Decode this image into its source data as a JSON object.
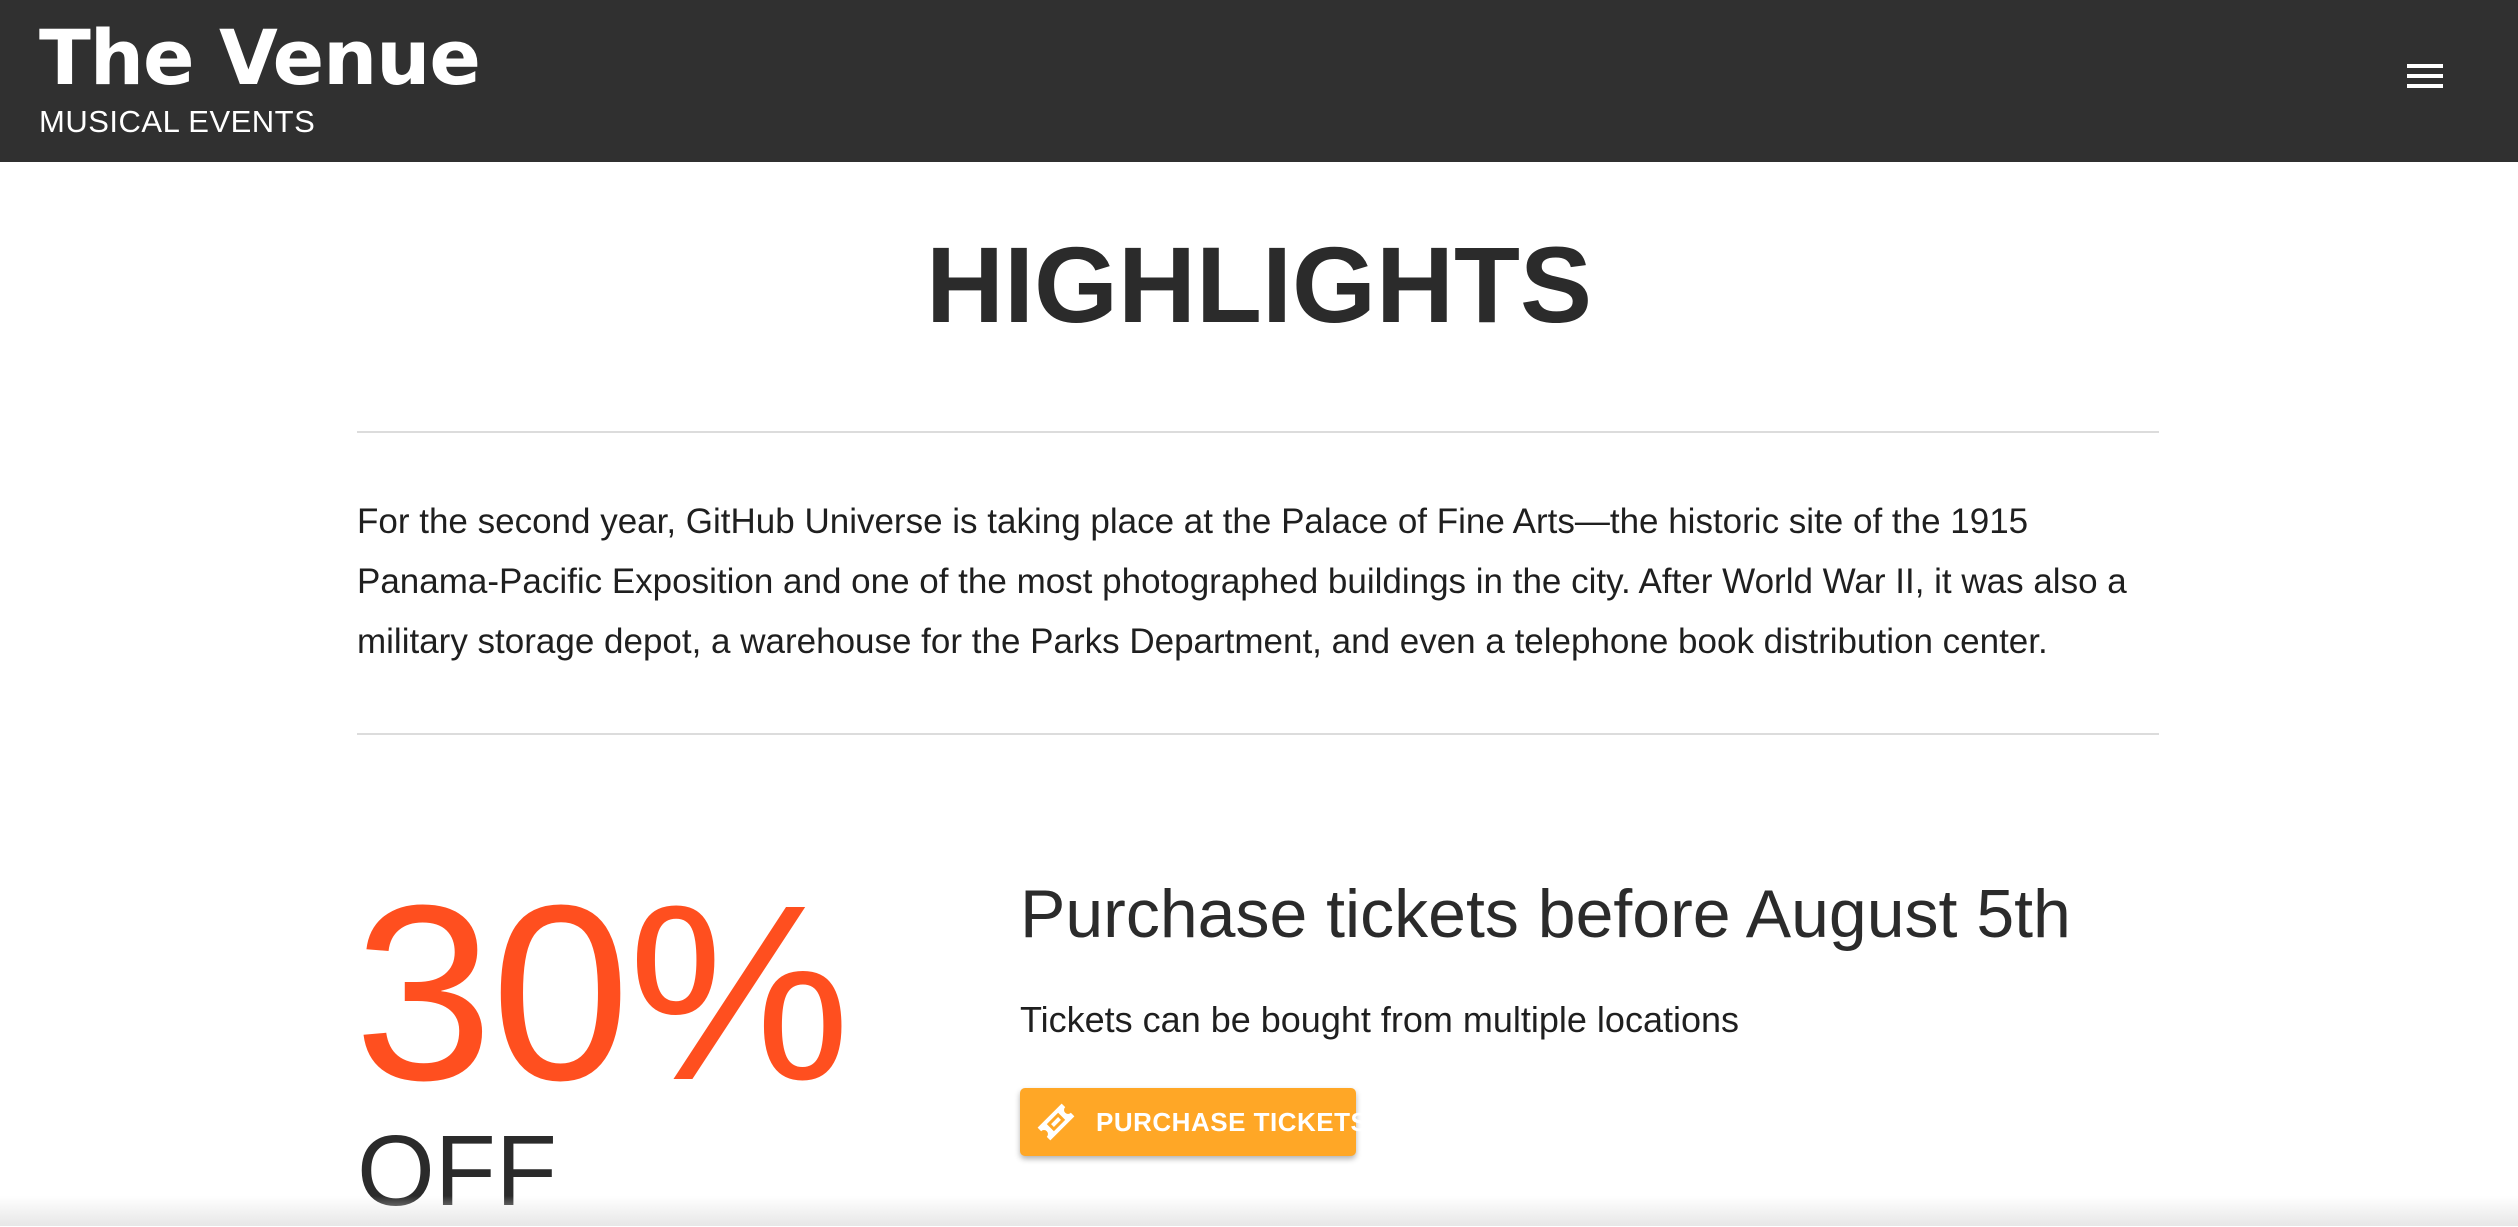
{
  "header": {
    "brand_title": "The Venue",
    "brand_subtitle": "MUSICAL EVENTS",
    "menu_icon": "hamburger-menu-icon",
    "background_color": "#303030"
  },
  "highlights": {
    "title": "HIGHLIGHTS",
    "intro": "For the second year, GitHub Universe is taking place at the Palace of Fine Arts—the historic site of the 1915 Panama-Pacific Exposition and one of the most photographed buildings in the city. After World War II, it was also a military storage depot, a warehouse for the Parks Department, and even a telephone book distribution center."
  },
  "promo": {
    "discount": "30%",
    "discount_suffix": "OFF",
    "heading": "Purchase tickets before August 5th",
    "subtext": "Tickets can be bought from multiple locations",
    "button_label": "PURCHASE TICKETS",
    "button_icon": "ticket-icon",
    "discount_color": "#ff4f1f",
    "button_color": "#ffa726"
  }
}
